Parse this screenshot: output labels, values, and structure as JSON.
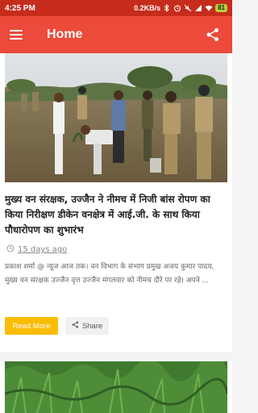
{
  "status_bar": {
    "time": "4:25 PM",
    "network_speed": "0.2KB/s",
    "battery": "81",
    "icons": [
      "bluetooth-icon",
      "alarm-icon",
      "mute-icon",
      "signal-icon",
      "wifi-icon",
      "battery-icon"
    ]
  },
  "app_bar": {
    "title": "Home",
    "menu_icon": "hamburger-menu-icon",
    "share_icon": "share-icon"
  },
  "article": {
    "title": "मुख्य वन संरक्षक, उज्जैन ने नीमच में निजी बांस रोपण का किया निरीक्षण डीकेन वनक्षेत्र में आई.जी. के साथ किया पौधारोपण का शुभारंभ",
    "date": "15 days ago",
    "summary": "प्रकाश शर्मा @ न्यूज आज तक। वन विभाग के संभाग प्रमुख अजय कुमार पादय, मुख्य वन संरक्षक उज्जैन वृत्त उज्जैन मंगलवार को नीमच दौरे पर रहे। अपने ...",
    "read_more_label": "Read More",
    "share_label": "Share"
  },
  "colors": {
    "status_bar": "#c62c1c",
    "app_bar": "#ec4a3b",
    "read_more": "#fbbc04"
  }
}
